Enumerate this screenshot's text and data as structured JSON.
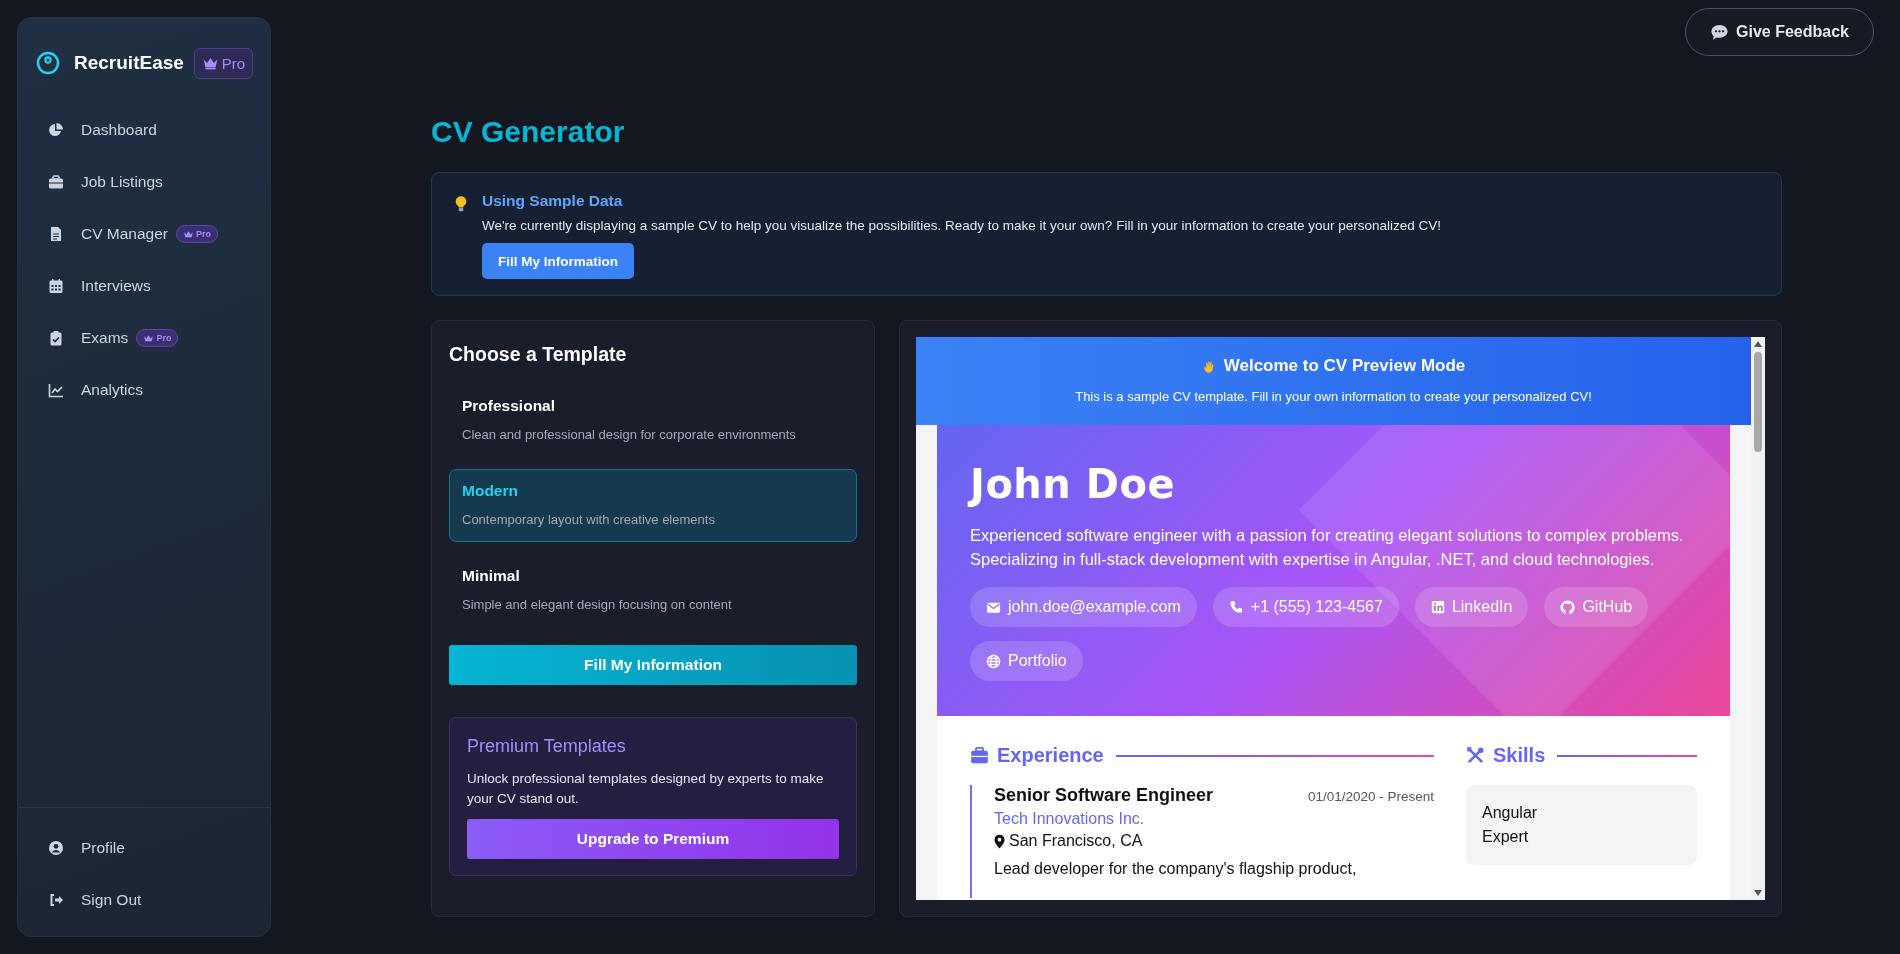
{
  "feedback_button": {
    "label": "Give Feedback"
  },
  "sidebar": {
    "brand": "RecruitEase",
    "brand_badge": "Pro",
    "items": [
      {
        "label": "Dashboard",
        "selected": false
      },
      {
        "label": "Job Listings",
        "selected": false
      },
      {
        "label": "CV Manager",
        "badge": "Pro",
        "selected": false
      },
      {
        "label": "Interviews",
        "selected": false
      },
      {
        "label": "Exams",
        "badge": "Pro",
        "selected": false
      },
      {
        "label": "Analytics",
        "selected": false
      }
    ],
    "bottom_items": [
      {
        "label": "Profile"
      },
      {
        "label": "Sign Out"
      }
    ]
  },
  "page_title": "CV Generator",
  "notice": {
    "title": "Using Sample Data",
    "text": "We're currently displaying a sample CV to help you visualize the possibilities. Ready to make it your own? Fill in your information to create your personalized CV!",
    "button": "Fill My Information"
  },
  "templates": {
    "title": "Choose a Template",
    "items": [
      {
        "name": "Professional",
        "description": "Clean and professional design for corporate environments",
        "selected": false
      },
      {
        "name": "Modern",
        "description": "Contemporary layout with creative elements",
        "selected": true
      },
      {
        "name": "Minimal",
        "description": "Simple and elegant design focusing on content",
        "selected": false
      }
    ],
    "button": "Fill My Information",
    "premium": {
      "title": "Premium Templates",
      "text": "Unlock professional templates designed by experts to make your CV stand out.",
      "button": "Upgrade to Premium"
    }
  },
  "preview": {
    "banner": {
      "title": "Welcome to CV Preview Mode",
      "text": "This is a sample CV template. Fill in your own information to create your personalized CV!"
    },
    "cv": {
      "name": "John Doe",
      "summary": "Experienced software engineer with a passion for creating elegant solutions to complex problems. Specializing in full-stack development with expertise in Angular, .NET, and cloud technologies.",
      "contacts": [
        {
          "kind": "email",
          "label": "john.doe@example.com"
        },
        {
          "kind": "phone",
          "label": "+1 (555) 123-4567"
        },
        {
          "kind": "linkedin",
          "label": "LinkedIn"
        },
        {
          "kind": "github",
          "label": "GitHub"
        },
        {
          "kind": "website",
          "label": "Portfolio"
        }
      ],
      "experience": {
        "title": "Experience",
        "jobs": [
          {
            "title": "Senior Software Engineer",
            "dates": "01/01/2020 - Present",
            "company": "Tech Innovations Inc.",
            "location": "San Francisco, CA",
            "description": "Lead developer for the company's flagship product,"
          }
        ]
      },
      "skills": {
        "title": "Skills",
        "items": [
          {
            "name": "Angular",
            "level": "Expert"
          }
        ]
      }
    }
  }
}
